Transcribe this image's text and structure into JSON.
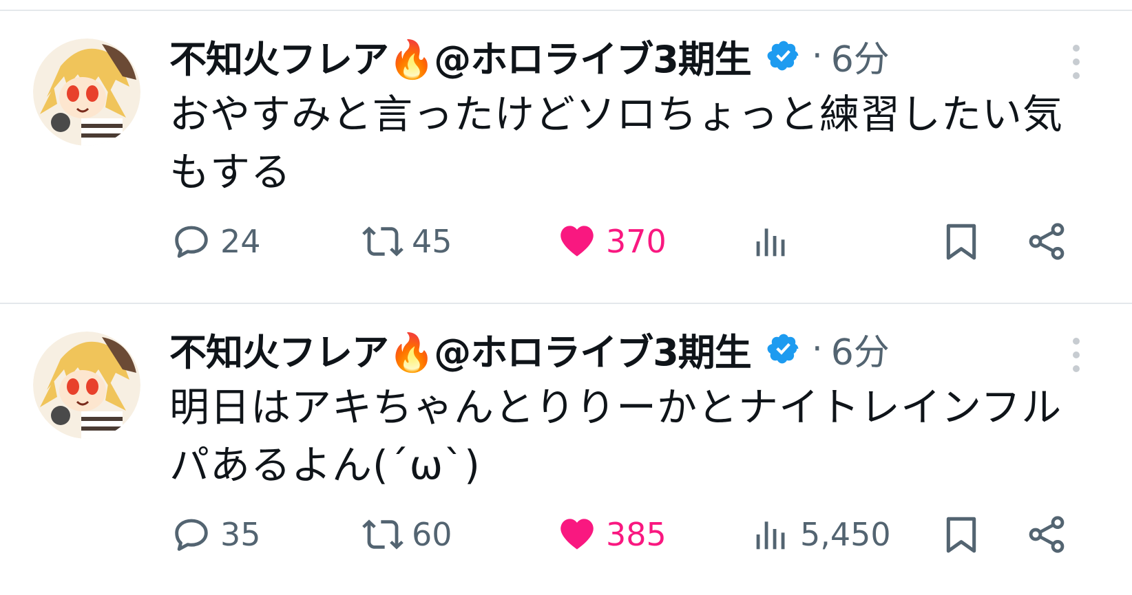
{
  "tweets": [
    {
      "display_name": "不知火フレア🔥@ホロライブ3期生",
      "separator": "·",
      "timestamp": "6分",
      "text": "おやすみと言ったけどソロちょっと練習したい気もする",
      "reply_count": "24",
      "retweet_count": "45",
      "like_count": "370",
      "view_count": "",
      "liked": true
    },
    {
      "display_name": "不知火フレア🔥@ホロライブ3期生",
      "separator": "·",
      "timestamp": "6分",
      "text": "明日はアキちゃんとりりーかとナイトレインフルパあるよん(´ω`)",
      "reply_count": "35",
      "retweet_count": "60",
      "like_count": "385",
      "view_count": "5,450",
      "liked": true
    }
  ],
  "icons": {
    "verified": "verified-badge-icon",
    "more": "more-vertical-icon",
    "reply": "reply-icon",
    "retweet": "retweet-icon",
    "like": "heart-icon",
    "views": "views-chart-icon",
    "bookmark": "bookmark-icon",
    "share": "share-icon"
  },
  "colors": {
    "text_primary": "#0f1419",
    "text_secondary": "#536471",
    "verified_blue": "#1d9bf0",
    "like_pink": "#f91880",
    "divider": "#e4e8eb"
  }
}
